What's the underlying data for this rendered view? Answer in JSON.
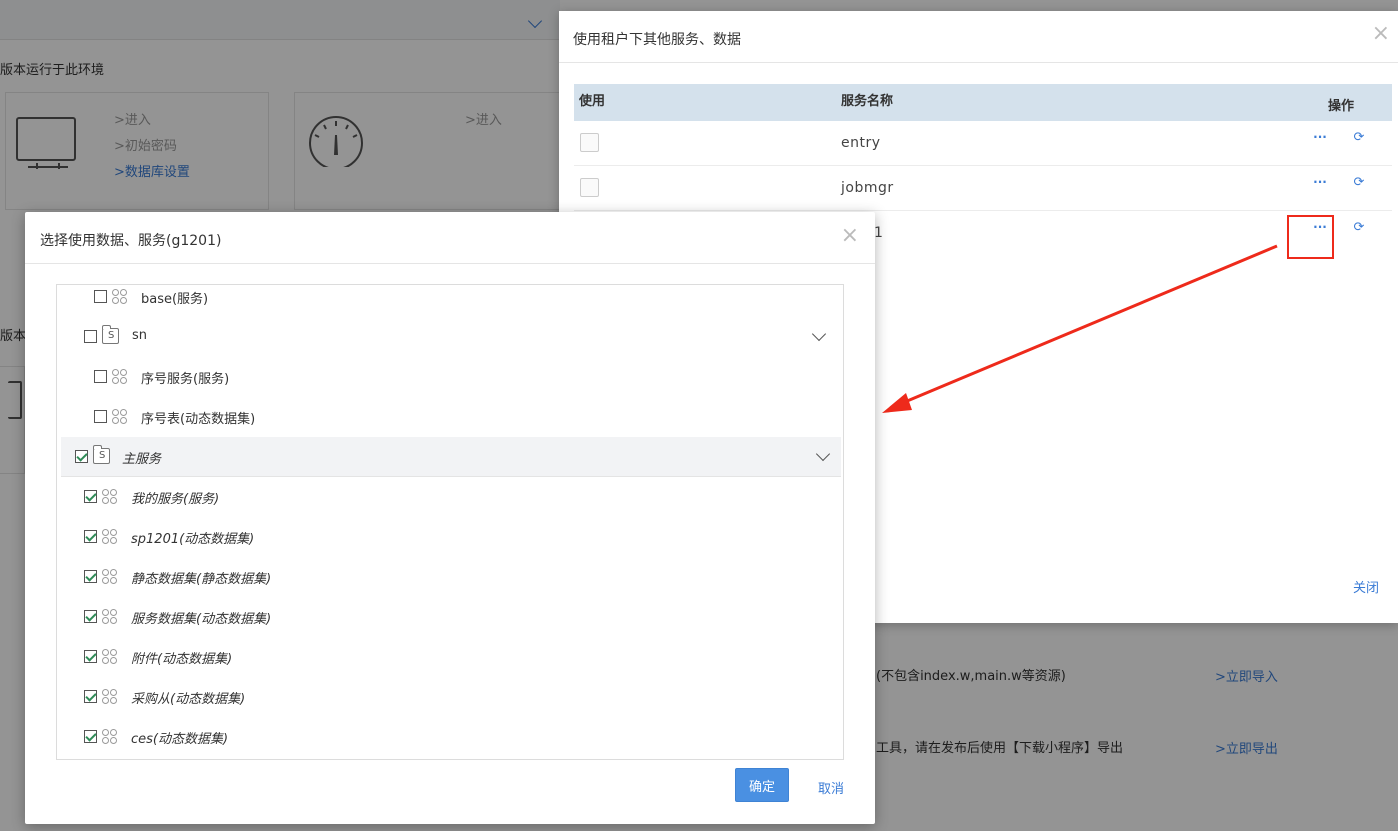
{
  "background": {
    "env_label": "版本运行于此环境",
    "card1_links": [
      ">进入",
      ">初始密码",
      ">数据库设置"
    ],
    "card2_links": [
      ">进入"
    ],
    "ver_label_2": "版本",
    "row1_text": "(不包含index.w,main.w等资源)",
    "row1_link": ">立即导入",
    "row2_text": "工具，请在发布后使用【下载小程序】导出",
    "row2_link": ">立即导出"
  },
  "panel": {
    "title": "使用租户下其他服务、数据",
    "close_icon": "×",
    "columns": {
      "use": "使用",
      "service_name": "服务名称",
      "actions": "操作"
    },
    "rows": [
      {
        "name": "entry",
        "more": "···",
        "refresh": "⟳"
      },
      {
        "name": "jobmgr",
        "more": "···",
        "refresh": "⟳"
      },
      {
        "name": "1",
        "more": "···",
        "refresh": "⟳"
      }
    ],
    "close_link": "关闭"
  },
  "modal": {
    "title": "选择使用数据、服务(g1201)",
    "close_icon": "×",
    "tree": [
      {
        "label": "base(服务)",
        "checked": false,
        "kind": "service",
        "indent": 2
      },
      {
        "label": "sn",
        "checked": false,
        "kind": "folder",
        "indent": 1,
        "expanded": true
      },
      {
        "label": "序号服务(服务)",
        "checked": false,
        "kind": "service",
        "indent": 2
      },
      {
        "label": "序号表(动态数据集)",
        "checked": false,
        "kind": "service",
        "indent": 2
      },
      {
        "label": "主服务",
        "checked": true,
        "kind": "folder",
        "indent": 0,
        "expanded": true
      },
      {
        "label": "我的服务(服务)",
        "checked": true,
        "kind": "service",
        "indent": 1
      },
      {
        "label": "sp1201(动态数据集)",
        "checked": true,
        "kind": "service",
        "indent": 1
      },
      {
        "label": "静态数据集(静态数据集)",
        "checked": true,
        "kind": "service",
        "indent": 1
      },
      {
        "label": "服务数据集(动态数据集)",
        "checked": true,
        "kind": "service",
        "indent": 1
      },
      {
        "label": "附件(动态数据集)",
        "checked": true,
        "kind": "service",
        "indent": 1
      },
      {
        "label": "采购从(动态数据集)",
        "checked": true,
        "kind": "service",
        "indent": 1
      },
      {
        "label": "ces(动态数据集)",
        "checked": true,
        "kind": "service",
        "indent": 1
      }
    ],
    "ok_label": "确定",
    "cancel_label": "取消"
  },
  "colors": {
    "accent": "#3a7bd5",
    "primary_button": "#4a90e2",
    "table_header": "#d4e1ec",
    "annotation_red": "#ee2a1b"
  },
  "icons": {
    "service": "service-cluster-icon",
    "folder": "folder-s-icon",
    "more": "ellipsis-icon",
    "refresh": "refresh-icon",
    "close": "close-icon",
    "chevron": "chevron-down-icon"
  }
}
